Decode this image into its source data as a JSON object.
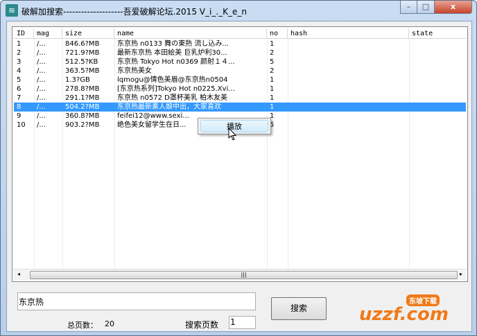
{
  "window": {
    "title": "破解加搜索--------------------吾爱破解论坛.2015 V_i_._K_e_n",
    "minimize": "–",
    "maximize": "□",
    "close": "x"
  },
  "table": {
    "columns": [
      "ID",
      "mag",
      "size",
      "name",
      "no",
      "hash",
      "state"
    ],
    "rows": [
      [
        "1",
        "/...",
        "846.6?MB",
        "东京热 n0133 舞の東熱 流し込み...",
        "1"
      ],
      [
        "2",
        "/...",
        "721.9?MB",
        "最新东京热 本田絵美 巨乳炉利30...",
        "2"
      ],
      [
        "3",
        "/...",
        "512.5?KB",
        "东京热 Tokyo Hot n0369 颜射１４...",
        "5"
      ],
      [
        "4",
        "/...",
        "363.5?MB",
        "东京热美女",
        "2"
      ],
      [
        "5",
        "/...",
        "1.3?GB",
        "lqmogu@情色美眉@东京热n0504",
        "1"
      ],
      [
        "6",
        "/...",
        "278.8?MB",
        "[东京热系列]Tokyo Hot n0225.Xvi...",
        "1"
      ],
      [
        "7",
        "/...",
        "291.1?MB",
        "东京热 n0572 D罩杯美乳 柏木友美",
        "1"
      ],
      [
        "8",
        "/...",
        "504.2?MB",
        "东京热最新素人娘中出，大家喜欢",
        "1"
      ],
      [
        "9",
        "/...",
        "360.8?MB",
        "feifei12@www.sexi...",
        "1"
      ],
      [
        "10",
        "/...",
        "903.2?MB",
        "绝色美女留学生在日...",
        "5"
      ]
    ],
    "selected_index": 7
  },
  "context_menu": {
    "play": "播放"
  },
  "search": {
    "query": "东京热",
    "button": "搜索",
    "total_pages_label": "总页数：",
    "total_pages": "20",
    "page_label": "搜索页数",
    "page_value": "1"
  },
  "logo": {
    "text": "uzzf.com",
    "badge": "东坡下载"
  }
}
